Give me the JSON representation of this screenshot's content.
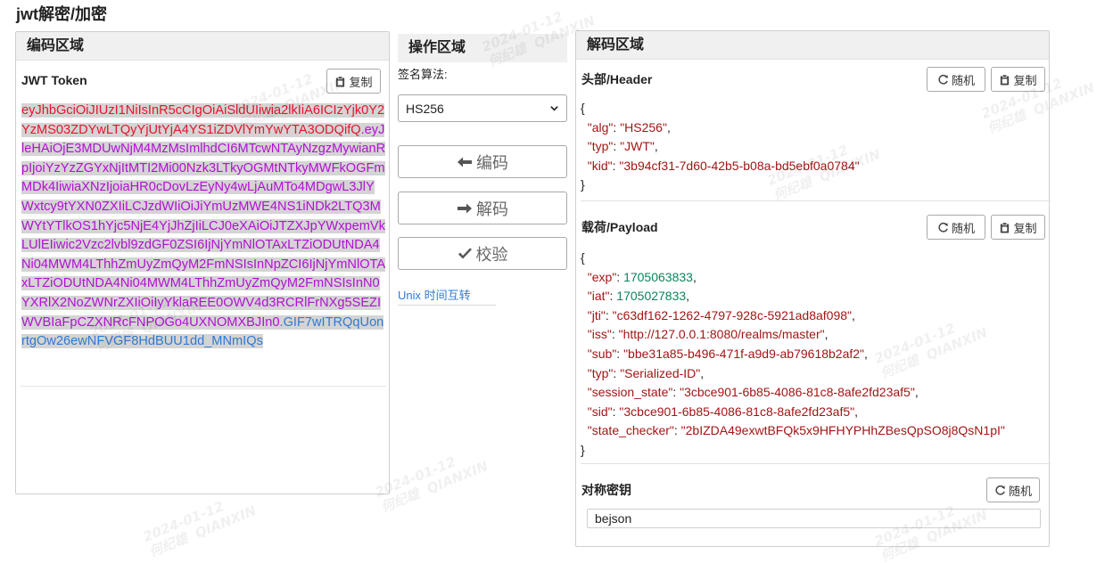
{
  "page": {
    "title": "jwt解密/加密"
  },
  "encoded": {
    "heading": "编码区域",
    "token_label": "JWT Token",
    "copy_label": "复制",
    "token_header": "eyJhbGciOiJIUzI1NiIsInR5cCIgOiAiSldUIiwia2lkIiA6ICIzYjk0Y2YzMS03ZDYwLTQyYjUtYjA4YS1iZDVlYmYwYTA3ODQifQ",
    "token_payload": "eyJleHAiOjE3MDUwNjM4MzMsImlhdCI6MTcwNTAyNzgzMywianRpIjoiYzYzZGYxNjItMTI2Mi00Nzk3LTkyOGMtNTkyMWFkOGFmMDk4IiwiaXNzIjoiaHR0cDovLzEyNy4wLjAuMTo4MDgwL3JlYWxtcy9tYXN0ZXIiLCJzdWIiOiJiYmUzMWE4NS1iNDk2LTQ3MWYtYTlkOS1hYjc5NjE4YjJhZjIiLCJ0eXAiOiJTZXJpYWxpemVkLUlEIiwic2Vzc2lvbl9zdGF0ZSI6IjNjYmNlOTAxLTZiODUtNDA4Ni04MWM4LThhZmUyZmQyM2FmNSIsInNpZCI6IjNjYmNlOTAxLTZiODUtNDA4Ni04MWM4LThhZmUyZmQyM2FmNSIsInN0YXRlX2NoZWNrZXIiOiIyYklaREE0OWV4d3RCRlFrNXg5SEZIWVBIaFpCZXNRcFNPOGo4UXNOMXBJIn0",
    "token_signature": "GIF7wITRQqUonrtgOw26ewNFVGF8HdBUU1dd_MNmIQs"
  },
  "operations": {
    "heading": "操作区域",
    "algo_label": "签名算法:",
    "algo_selected": "HS256",
    "encode_label": "编码",
    "decode_label": "解码",
    "verify_label": "校验",
    "unix_link": "Unix 时间互转"
  },
  "decoded": {
    "heading": "解码区域",
    "header_label": "头部/Header",
    "payload_label": "载荷/Payload",
    "secret_label": "对称密钥",
    "random_label": "随机",
    "copy_label": "复制",
    "secret_value": "bejson",
    "header_json": [
      {
        "key": "alg",
        "value": "HS256",
        "type": "string"
      },
      {
        "key": "typ",
        "value": "JWT",
        "type": "string"
      },
      {
        "key": "kid",
        "value": "3b94cf31-7d60-42b5-b08a-bd5ebf0a0784",
        "type": "string"
      }
    ],
    "payload_json": [
      {
        "key": "exp",
        "value": "1705063833",
        "type": "number"
      },
      {
        "key": "iat",
        "value": "1705027833",
        "type": "number"
      },
      {
        "key": "jti",
        "value": "c63df162-1262-4797-928c-5921ad8af098",
        "type": "string"
      },
      {
        "key": "iss",
        "value": "http://127.0.0.1:8080/realms/master",
        "type": "string"
      },
      {
        "key": "sub",
        "value": "bbe31a85-b496-471f-a9d9-ab79618b2af2",
        "type": "string"
      },
      {
        "key": "typ",
        "value": "Serialized-ID",
        "type": "string"
      },
      {
        "key": "session_state",
        "value": "3cbce901-6b85-4086-81c8-8afe2fd23af5",
        "type": "string"
      },
      {
        "key": "sid",
        "value": "3cbce901-6b85-4086-81c8-8afe2fd23af5",
        "type": "string"
      },
      {
        "key": "state_checker",
        "value": "2bIZDA49exwtBFQk5x9HFHYPHhZBesQpSO8j8QsN1pI",
        "type": "string"
      }
    ]
  },
  "watermark": {
    "date": "2024-01-12",
    "name": "何纪雄",
    "org": "QIANXIN"
  }
}
